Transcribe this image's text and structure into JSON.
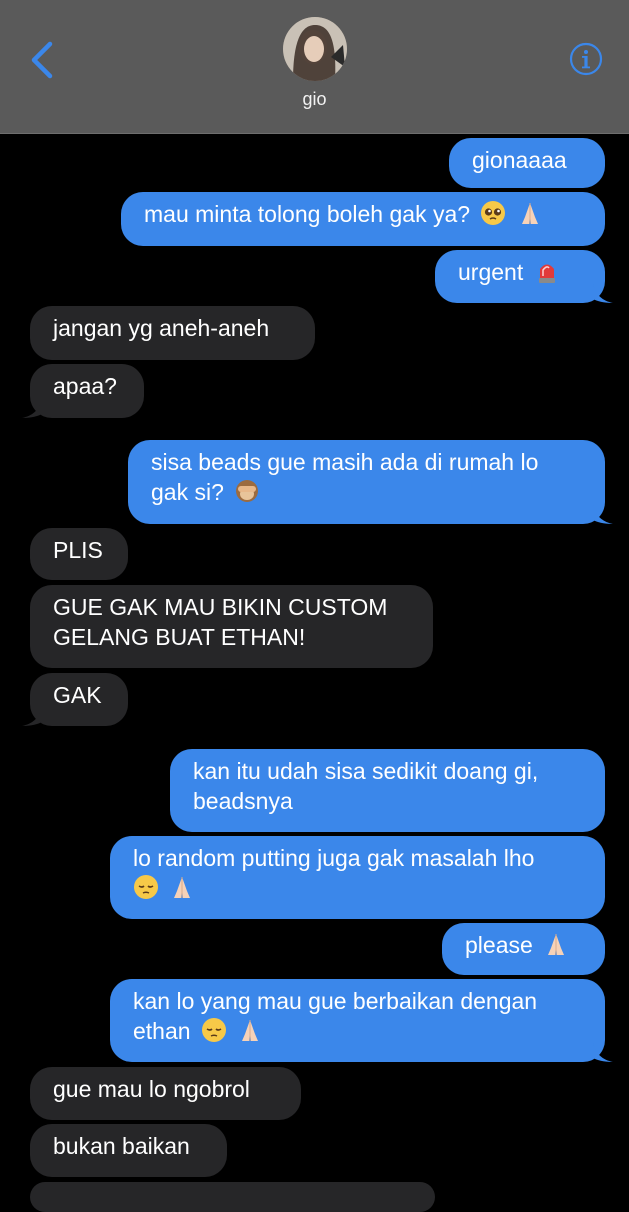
{
  "header": {
    "contact_name": "gio",
    "colors": {
      "background": "#5a5a5a",
      "accent": "#3b87ea"
    }
  },
  "messages": [
    {
      "from": "me",
      "lines": [
        "gionaaaa"
      ]
    },
    {
      "from": "me",
      "lines": [
        "mau minta tolong boleh gak ya?"
      ],
      "emojis": [
        "pleading-face",
        "folded-hands"
      ]
    },
    {
      "from": "me",
      "lines": [
        "urgent"
      ],
      "emojis": [
        "police-light"
      ]
    },
    {
      "from": "them",
      "lines": [
        "jangan yg aneh-aneh"
      ]
    },
    {
      "from": "them",
      "lines": [
        "apaa?"
      ]
    },
    {
      "from": "me",
      "lines": [
        "sisa beads gue masih ada di rumah lo",
        "gak si?"
      ],
      "emojis": [
        "see-no-evil-monkey"
      ]
    },
    {
      "from": "them",
      "lines": [
        "PLIS"
      ]
    },
    {
      "from": "them",
      "lines": [
        "GUE GAK MAU BIKIN CUSTOM",
        "GELANG BUAT ETHAN!"
      ]
    },
    {
      "from": "them",
      "lines": [
        "GAK"
      ]
    },
    {
      "from": "me",
      "lines": [
        "kan itu udah sisa sedikit doang gi,",
        "beadsnya"
      ]
    },
    {
      "from": "me",
      "lines": [
        "lo random putting juga gak masalah lho",
        ""
      ],
      "emojis": [
        "pensive-face",
        "folded-hands"
      ]
    },
    {
      "from": "me",
      "lines": [
        "please"
      ],
      "emojis": [
        "folded-hands"
      ]
    },
    {
      "from": "me",
      "lines": [
        "kan lo yang mau gue berbaikan dengan",
        "ethan"
      ],
      "emojis": [
        "pensive-face",
        "folded-hands"
      ]
    },
    {
      "from": "them",
      "lines": [
        "gue mau lo ngobrol"
      ]
    },
    {
      "from": "them",
      "lines": [
        "bukan baikan"
      ]
    }
  ]
}
